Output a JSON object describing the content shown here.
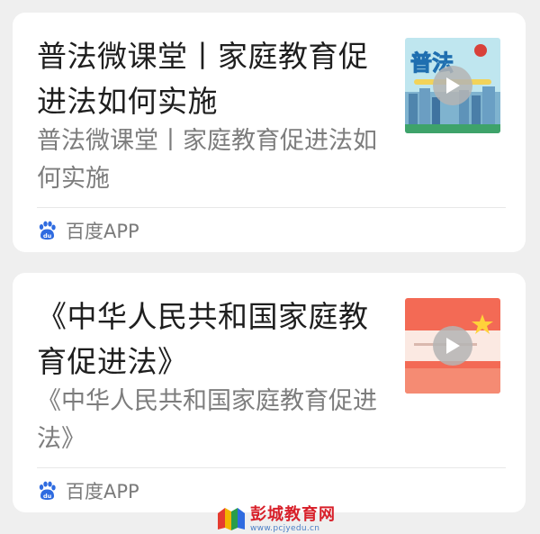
{
  "cards": [
    {
      "title": "普法微课堂丨家庭教育促进法如何实施",
      "subtitle": "普法微课堂丨家庭教育促进法如何实施",
      "source": "百度APP",
      "thumb_text": "普法"
    },
    {
      "title": "《中华人民共和国家庭教育促进法》",
      "subtitle": "《中华人民共和国家庭教育促进法》",
      "source": "百度APP"
    }
  ],
  "watermark": {
    "brand": "彭城教育网",
    "url": "www.pcjyedu.cn"
  },
  "colors": {
    "background": "#efefef",
    "card": "#ffffff",
    "title": "#1e1e1e",
    "subtitle": "#7d7d7d",
    "baidu_blue": "#2f6be0",
    "watermark_red": "#d8202a"
  }
}
